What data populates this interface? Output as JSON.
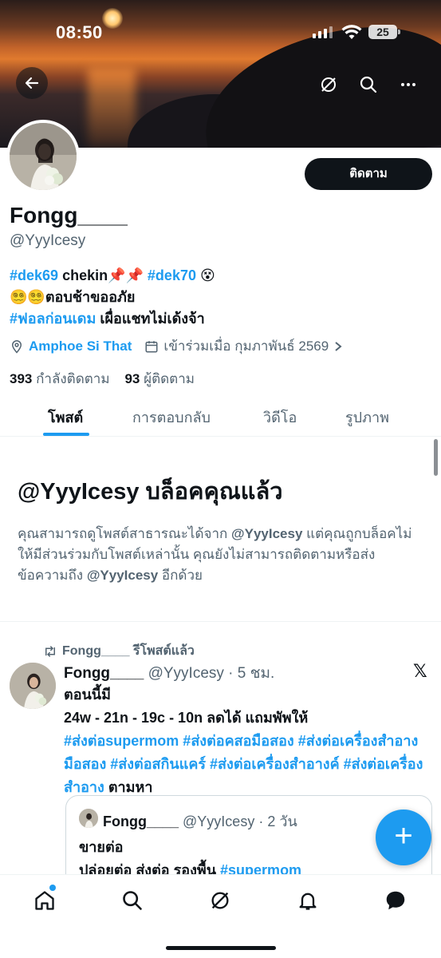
{
  "status_bar": {
    "time": "08:50",
    "battery": "25"
  },
  "header": {
    "back_icon": "arrow-left-icon",
    "actions": [
      "grok-icon",
      "search-icon",
      "more-icon"
    ]
  },
  "profile": {
    "follow_label": "ติดตาม",
    "display_name": "Fongg____",
    "handle": "@YyyIcesy",
    "bio": {
      "line1_tag1": "#dek69",
      "line1_text": " chekin📌📌 ",
      "line1_tag2": "#dek70",
      "line1_emoji": " 😵",
      "line2": "😵‍💫😵‍💫ตอบช้าขออภัย",
      "line3_tag": "#ฟอลก่อนเดม",
      "line3_text": " เผื่อแชทไม่เด้งจ้า"
    },
    "location": "Amphoe Si That",
    "joined": "เข้าร่วมเมื่อ กุมภาพันธ์ 2569",
    "following_count": "393",
    "following_label": "กำลังติดตาม",
    "followers_count": "93",
    "followers_label": "ผู้ติดตาม"
  },
  "tabs": [
    "โพสต์",
    "การตอบกลับ",
    "วิดีโอ",
    "รูปภาพ"
  ],
  "blocked": {
    "title": "@YyyIcesy บล็อคคุณแล้ว",
    "description_1": "คุณสามารถดูโพสต์สาธารณะได้จาก ",
    "handle_a": "@YyyIcesy",
    "description_2": " แต่คุณถูกบล็อคไม่ให้มีส่วนร่วมกับโพสต์เหล่านั้น คุณยังไม่สามารถติดตามหรือส่งข้อความถึง ",
    "handle_b": "@YyyIcesy",
    "description_3": " อีกด้วย"
  },
  "post": {
    "repost_label": "Fongg____ รีโพสต์แล้ว",
    "author": "Fongg____",
    "meta": " @YyyIcesy · 5 ชม.",
    "line1": "ตอนนี้มี",
    "line2": "24w - 21n - 19c - 10n ลดได้ แถมพัพให้",
    "tags_line_a": " #ส่งต่อsupermom #ส่งต่อคสอมือสอง #ส่งต่อเครื่องสำอางมือสอง #ส่งต่อสกินแคร์ #ส่งต่อเครื่องสำอางค์ #ส่งต่อเครื่องสำอาง",
    "tags_suffix": " ตามหา",
    "quote": {
      "author": "Fongg____",
      "meta": " @YyyIcesy · 2 วัน",
      "line1": "ขายต่อ",
      "line2": "ปล่อยต่อ ส่งต่อ รองพื้น ",
      "line2_tag": "#supermom"
    }
  },
  "fab_label": "+",
  "bottom_nav": [
    "home-icon",
    "search-icon",
    "grok-icon",
    "notifications-icon",
    "messages-icon"
  ],
  "colors": {
    "accent": "#1d9bf0",
    "text": "#0f1419",
    "secondary": "#536471"
  }
}
